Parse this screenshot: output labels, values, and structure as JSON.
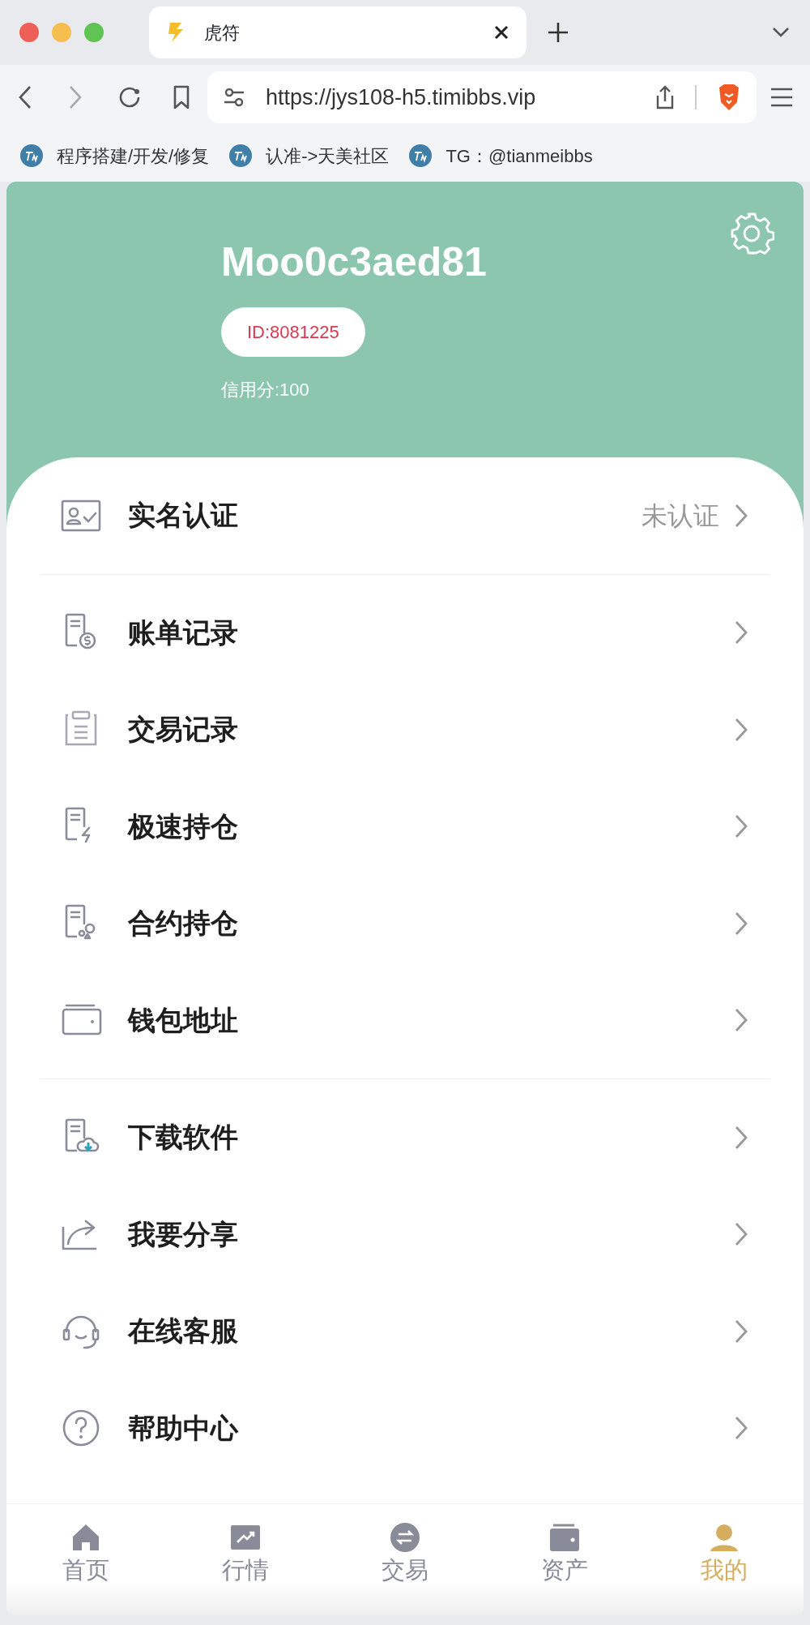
{
  "browser": {
    "tab_title": "虎符",
    "url": "https://jys108-h5.timibbs.vip",
    "bookmarks": [
      "程序搭建/开发/修复",
      "认准->天美社区",
      "TG：@tianmeibbs"
    ]
  },
  "profile": {
    "username": "Moo0c3aed81",
    "id": "ID:8081225",
    "credit": "信用分:100"
  },
  "menu_groups": [
    [
      {
        "label": "实名认证",
        "status": "未认证"
      }
    ],
    [
      {
        "label": "账单记录"
      },
      {
        "label": "交易记录"
      },
      {
        "label": "极速持仓"
      },
      {
        "label": "合约持仓"
      },
      {
        "label": "钱包地址"
      }
    ],
    [
      {
        "label": "下载软件"
      },
      {
        "label": "我要分享"
      },
      {
        "label": "在线客服"
      },
      {
        "label": "帮助中心"
      }
    ]
  ],
  "bottom_nav": [
    {
      "label": "首页",
      "selected": false
    },
    {
      "label": "行情",
      "selected": false
    },
    {
      "label": "交易",
      "selected": false
    },
    {
      "label": "资产",
      "selected": false
    },
    {
      "label": "我的",
      "selected": true
    }
  ]
}
